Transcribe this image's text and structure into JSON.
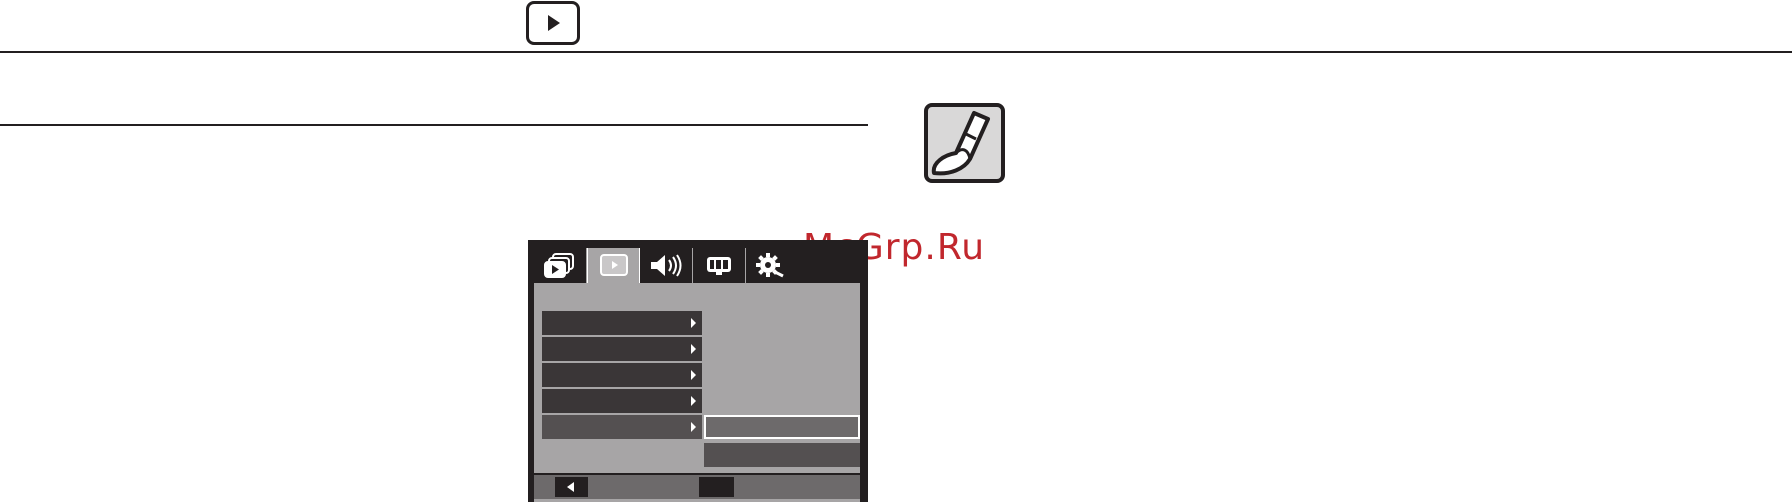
{
  "header": {
    "section_icon": "play-icon"
  },
  "note": {
    "icon": "pencil-note-icon"
  },
  "watermark": {
    "text": "McGrp.Ru",
    "color": "#c1272d"
  },
  "camera_menu": {
    "tabs": [
      {
        "icon": "playback-stack-icon",
        "active": false
      },
      {
        "icon": "play-icon",
        "active": true
      },
      {
        "icon": "speaker-icon",
        "active": false
      },
      {
        "icon": "display-icon",
        "active": false
      },
      {
        "icon": "settings-gear-icon",
        "active": false
      }
    ],
    "items": [
      {
        "label": ""
      },
      {
        "label": ""
      },
      {
        "label": ""
      },
      {
        "label": ""
      },
      {
        "label": "",
        "selected": true
      }
    ],
    "options": [
      {
        "label": "",
        "selected": true
      },
      {
        "label": ""
      }
    ],
    "bottom_bar": {
      "back_icon": "back-arrow-icon",
      "ok_label": ""
    },
    "colors": {
      "frame": "#231f20",
      "body": "#a7a5a6",
      "item": "#3a3637"
    }
  }
}
